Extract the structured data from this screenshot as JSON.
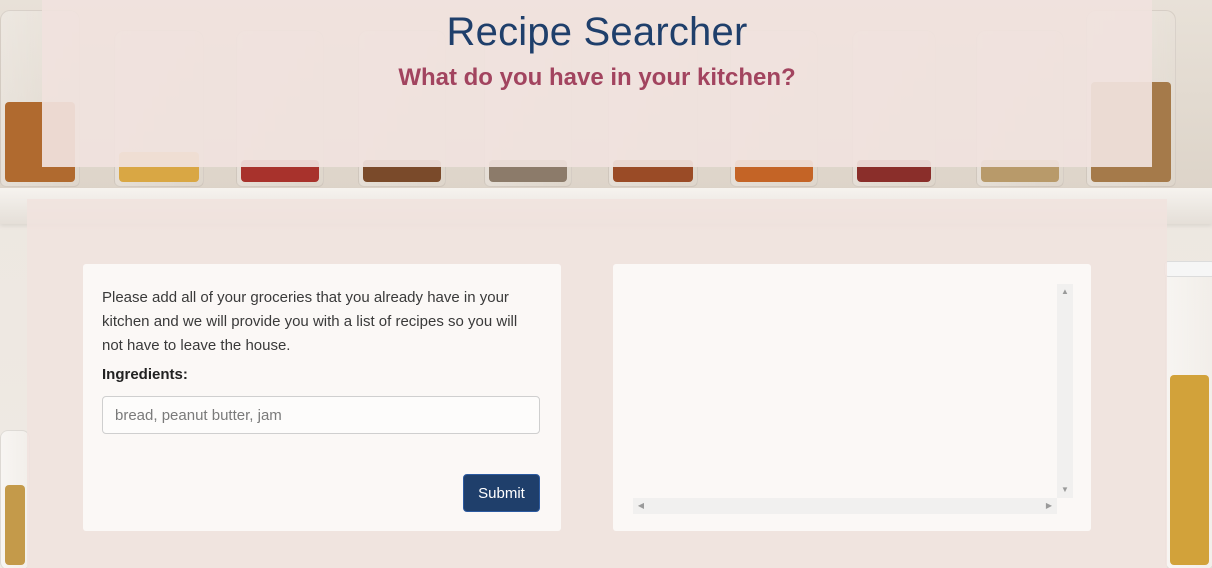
{
  "header": {
    "title": "Recipe Searcher",
    "subtitle": "What do you have in your kitchen?"
  },
  "search_card": {
    "intro_text": "Please add all of your groceries that you already have in your kitchen and we will provide you with a list of recipes so you will not have to leave the house.",
    "ingredients_label": "Ingredients:",
    "ingredients_input": {
      "value": "",
      "placeholder": "bread, peanut butter, jam"
    },
    "submit_label": "Submit"
  },
  "results": {
    "items": [],
    "scroll_icons": [
      "arrow-up-icon",
      "arrow-down-icon",
      "arrow-left-icon",
      "arrow-right-icon"
    ]
  },
  "colors": {
    "title": "#1f3f6b",
    "subtitle": "#a2445f",
    "button": "#1f3f6b",
    "panel": "#f0e2de"
  }
}
